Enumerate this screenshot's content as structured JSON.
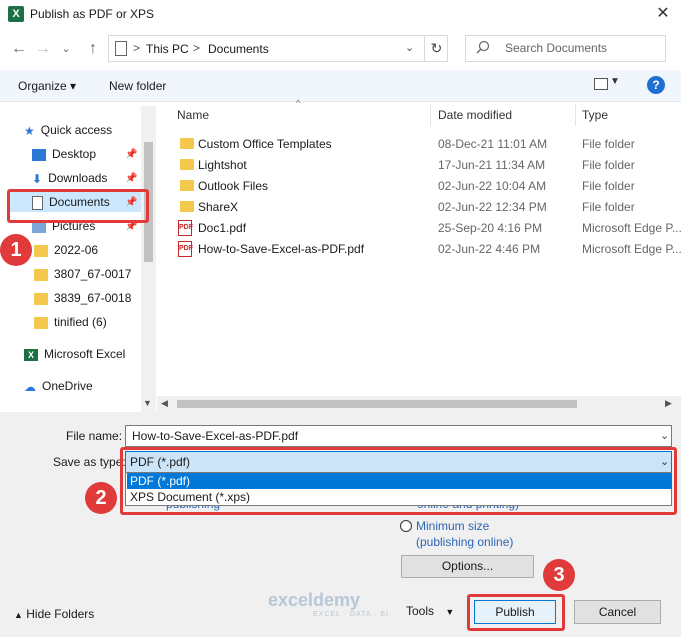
{
  "window": {
    "title": "Publish as PDF or XPS",
    "app_icon_text": "X"
  },
  "nav": {
    "path": [
      "This PC",
      "Documents"
    ],
    "path_sep": ">",
    "search_placeholder": "Search Documents"
  },
  "toolbar": {
    "organize": "Organize",
    "organize_caret": "▾",
    "new_folder": "New folder",
    "help": "?"
  },
  "sidebar": {
    "items": [
      {
        "label": "Quick access",
        "icon": "star-icon"
      },
      {
        "label": "Desktop",
        "icon": "desktop-icon",
        "pinned": true
      },
      {
        "label": "Downloads",
        "icon": "download-icon",
        "pinned": true
      },
      {
        "label": "Documents",
        "icon": "document-icon",
        "pinned": true
      },
      {
        "label": "Pictures",
        "icon": "pictures-icon",
        "pinned": true
      },
      {
        "label": "2022-06",
        "icon": "folder-icon"
      },
      {
        "label": "3807_67-0017",
        "icon": "folder-icon"
      },
      {
        "label": "3839_67-0018",
        "icon": "folder-icon"
      },
      {
        "label": "tinified (6)",
        "icon": "folder-icon"
      },
      {
        "label": "Microsoft Excel",
        "icon": "excel-icon"
      },
      {
        "label": "OneDrive",
        "icon": "onedrive-icon"
      }
    ]
  },
  "columns": {
    "name": "Name",
    "date": "Date modified",
    "type": "Type"
  },
  "files": [
    {
      "name": "Custom Office Templates",
      "date": "08-Dec-21 11:01 AM",
      "type": "File folder",
      "kind": "folder"
    },
    {
      "name": "Lightshot",
      "date": "17-Jun-21 11:34 AM",
      "type": "File folder",
      "kind": "folder"
    },
    {
      "name": "Outlook Files",
      "date": "02-Jun-22 10:04 AM",
      "type": "File folder",
      "kind": "folder"
    },
    {
      "name": "ShareX",
      "date": "02-Jun-22 12:34 PM",
      "type": "File folder",
      "kind": "folder"
    },
    {
      "name": "Doc1.pdf",
      "date": "25-Sep-20 4:16 PM",
      "type": "Microsoft Edge P...",
      "kind": "pdf"
    },
    {
      "name": "How-to-Save-Excel-as-PDF.pdf",
      "date": "02-Jun-22 4:46 PM",
      "type": "Microsoft Edge P...",
      "kind": "pdf"
    }
  ],
  "form": {
    "filename_label": "File name:",
    "filename_value": "How-to-Save-Excel-as-PDF.pdf",
    "savetype_label": "Save as type:",
    "savetype_value": "PDF (*.pdf)",
    "savetype_options": [
      "PDF (*.pdf)",
      "XPS Document (*.xps)"
    ],
    "behind_text_1": "online and printing)",
    "behind_text_2": "publishing",
    "minimum_size": "Minimum size",
    "minimum_size_sub": "(publishing online)",
    "options": "Options...",
    "hide_folders": "Hide Folders",
    "tools": "Tools",
    "publish": "Publish",
    "cancel": "Cancel"
  },
  "annotations": [
    "1",
    "2",
    "3"
  ],
  "watermark": {
    "brand": "exceldemy",
    "tagline": "EXCEL · DATA · BI"
  },
  "colors": {
    "accent": "#0078d7",
    "annotation": "#e03a3a",
    "folder": "#f3c94d"
  }
}
